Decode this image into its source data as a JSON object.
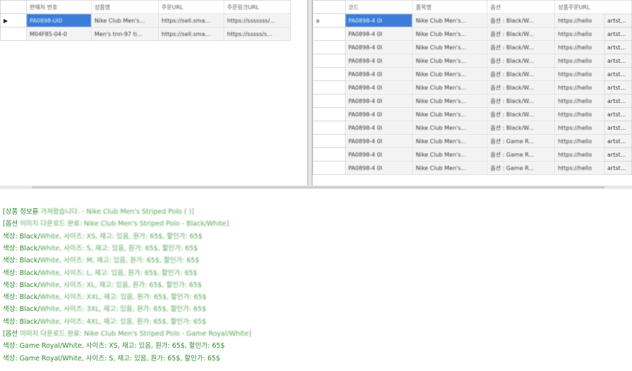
{
  "left_grid": {
    "columns": [
      "판매처 번호",
      "상품명",
      "주문URL",
      "주문링크URL"
    ],
    "rows": [
      {
        "selected": true,
        "cells": [
          "PA0898-UI0",
          "Nike Club Men's...",
          "https://sell.sma...",
          "https://sssssss/..."
        ]
      },
      {
        "selected": false,
        "cells": [
          "M04F85-04-0",
          "Men's tnn-97 ti...",
          "https://sell.sma...",
          "https://sssss/s..."
        ]
      }
    ],
    "current_row_marker": "▶"
  },
  "right_grid": {
    "columns": [
      "코드",
      "품목명",
      "옵션",
      "상품주문URL"
    ],
    "rows": [
      {
        "selected": true,
        "marker": "a",
        "cells": [
          "PA0898-4 0I",
          "Nike Club Men's...",
          "옵션 : Black/W...",
          "https://hello"
        ],
        "tail": "artst..."
      },
      {
        "selected": false,
        "marker": "",
        "cells": [
          "PA0898-4 0I",
          "Nike Club Men's...",
          "옵션 : Black/W...",
          "https://hello"
        ],
        "tail": "artst..."
      },
      {
        "selected": false,
        "marker": "",
        "cells": [
          "PA0898-4 0I",
          "Nike Club Men's...",
          "옵션 : Black/W...",
          "https://hello"
        ],
        "tail": "artst..."
      },
      {
        "selected": false,
        "marker": "",
        "cells": [
          "PA0898-4 0I",
          "Nike Club Men's...",
          "옵션 : Black/W...",
          "https://hello"
        ],
        "tail": "artst..."
      },
      {
        "selected": false,
        "marker": "",
        "cells": [
          "PA0898-4 0I",
          "Nike Club Men's...",
          "옵션 : Black/W...",
          "https://hello"
        ],
        "tail": "artst..."
      },
      {
        "selected": false,
        "marker": "",
        "cells": [
          "PA0898-4 0I",
          "Nike Club Men's...",
          "옵션 : Black/W...",
          "https://hello"
        ],
        "tail": "artst..."
      },
      {
        "selected": false,
        "marker": "",
        "cells": [
          "PA0898-4 0I",
          "Nike Club Men's...",
          "옵션 : Black/W...",
          "https://hello"
        ],
        "tail": "artst..."
      },
      {
        "selected": false,
        "marker": "",
        "cells": [
          "PA0898-4 0I",
          "Nike Club Men's...",
          "옵션 : Black/W...",
          "https://hello"
        ],
        "tail": "artst..."
      },
      {
        "selected": false,
        "marker": "",
        "cells": [
          "PA0898-4 0I",
          "Nike Club Men's...",
          "옵션 : Black/W...",
          "https://hello"
        ],
        "tail": "artst..."
      },
      {
        "selected": false,
        "marker": "",
        "cells": [
          "PA0898-4 0I",
          "Nike Club Men's...",
          "옵션 : Game R...",
          "https://hello"
        ],
        "tail": "artst..."
      },
      {
        "selected": false,
        "marker": "",
        "cells": [
          "PA0898-4 0I",
          "Nike Club Men's...",
          "옵션 : Game R...",
          "https://hello"
        ],
        "tail": "artst..."
      },
      {
        "selected": false,
        "marker": "",
        "cells": [
          "PA0898-4 0I",
          "Nike Club Men's...",
          "옵션 : Game R...",
          "https://hello"
        ],
        "tail": "artst..."
      }
    ]
  },
  "log": {
    "lines": [
      {
        "head": "[상품 정보를 ",
        "tail": "가져왔습니다. - Nike Club Men's Striped Polo (  )]",
        "soft": true
      },
      {
        "head": "[옵션 ",
        "tail": "이미지 다운로드 완료: Nike Club Men's Striped Polo - Black/White]",
        "soft": true
      },
      {
        "head": "색상: Black/",
        "tail": "White, 사이즈: XS, 재고: 있음, 원가: 65$, 할인가: 65$",
        "soft": true
      },
      {
        "head": "색상: Black/",
        "tail": "White, 사이즈: S, 재고: 있음, 원가: 65$, 할인가: 65$",
        "soft": true
      },
      {
        "head": "색상: Black/",
        "tail": "White, 사이즈: M, 재고: 있음, 원가: 65$, 할인가: 65$",
        "soft": true
      },
      {
        "head": "색상: Black/",
        "tail": "White, 사이즈: L, 재고: 있음, 원가: 65$, 할인가: 65$",
        "soft": true
      },
      {
        "head": "색상: Black/",
        "tail": "White, 사이즈: XL, 재고: 있음, 원가: 65$, 할인가: 65$",
        "soft": true
      },
      {
        "head": "색상: Black/",
        "tail": "White, 사이즈: XXL, 재고: 있음, 원가: 65$, 할인가: 65$",
        "soft": true
      },
      {
        "head": "색상: Black/",
        "tail": "White, 사이즈: 3XL, 재고: 있음, 원가: 65$, 할인가: 65$",
        "soft": true
      },
      {
        "head": "색상: Black/",
        "tail": "White, 사이즈: 4XL, 재고: 있음, 원가: 65$, 할인가: 65$",
        "soft": true
      },
      {
        "head": "[옵션 ",
        "tail": "이미지 다운로드 완료: Nike Club Men's Striped Polo - Game Royal/White]",
        "soft": true
      },
      {
        "head": "색상: Game Royal/White, 사이즈: XS, 재고: 있음, 원가: 65$, 할인가: 65$",
        "tail": "",
        "soft": false
      },
      {
        "head": "색상: Game Royal/White, 사이즈: S, 재고: 있음, 원가: 65$, 할인가: 65$",
        "tail": "",
        "soft": false
      }
    ]
  }
}
